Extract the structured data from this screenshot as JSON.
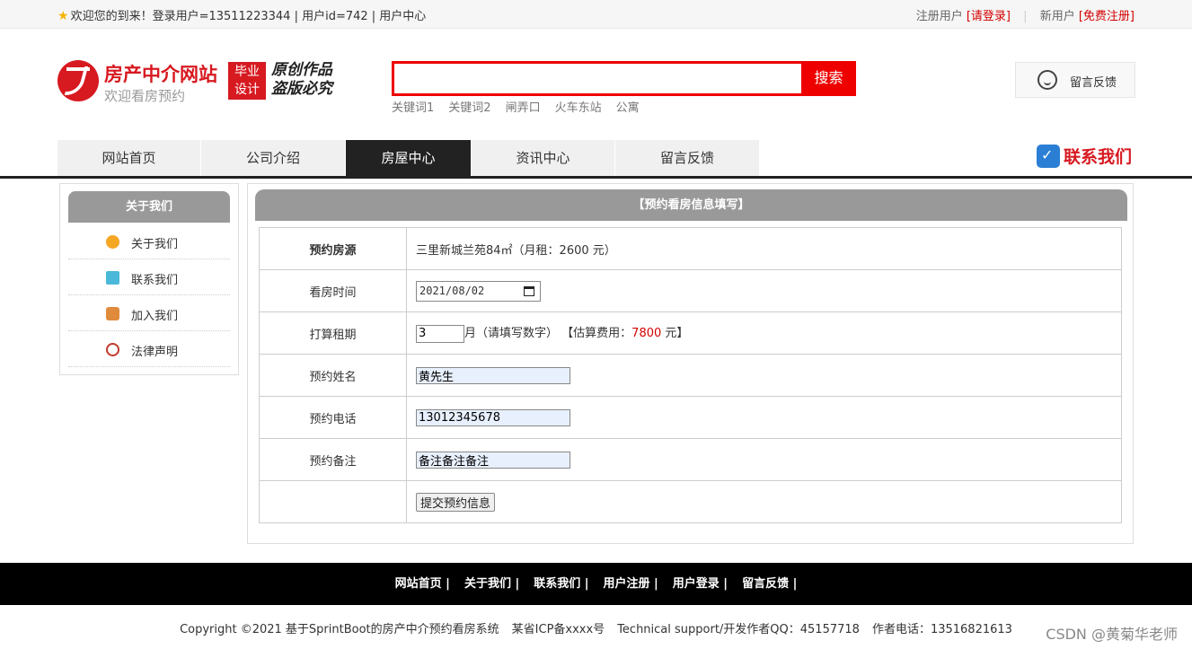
{
  "topbar": {
    "welcome": "欢迎您的到来！登录用户=13511223344 | 用户id=742 | 用户中心",
    "registered_user": "注册用户",
    "login_link": "[请登录]",
    "new_user": "新用户",
    "register_link": "[免费注册]"
  },
  "header": {
    "site_title": "房产中介网站",
    "site_subtitle": "欢迎看房预约",
    "badge_line1": "毕业",
    "badge_line2": "设计",
    "slogan_line1": "原创作品",
    "slogan_line2": "盗版必究",
    "search_button": "搜索",
    "search_value": "",
    "keywords": [
      "关键词1",
      "关键词2",
      "闸弄口",
      "火车东站",
      "公寓"
    ],
    "feedback_button": "留言反馈"
  },
  "nav": {
    "items": [
      "网站首页",
      "公司介绍",
      "房屋中心",
      "资讯中心",
      "留言反馈"
    ],
    "active_index": 2,
    "contact": "联系我们"
  },
  "sidebar": {
    "title": "关于我们",
    "items": [
      "关于我们",
      "联系我们",
      "加入我们",
      "法律声明"
    ]
  },
  "form": {
    "title": "【预约看房信息填写】",
    "rows": {
      "house_label": "预约房源",
      "house_value": "三里新城兰苑84㎡（月租：2600 元）",
      "time_label": "看房时间",
      "time_value": "2021/08/02",
      "term_label": "打算租期",
      "term_value": "3",
      "term_hint": "月（请填写数字）",
      "estimate_prefix": "【估算费用：",
      "estimate_value": "7800",
      "estimate_suffix": " 元】",
      "name_label": "预约姓名",
      "name_value": "黄先生",
      "phone_label": "预约电话",
      "phone_value": "13012345678",
      "note_label": "预约备注",
      "note_value": "备注备注备注",
      "submit": "提交预约信息"
    }
  },
  "footer": {
    "links": [
      "网站首页 |",
      "关于我们 |",
      "联系我们 |",
      "用户注册 |",
      "用户登录 |",
      "留言反馈 |"
    ],
    "copyright": "Copyright ©2021 基于SprintBoot的房产中介预约看房系统",
    "icp": "某省ICP备xxxx号",
    "support": "Technical support/开发作者QQ：45157718",
    "phone": "作者电话：13516821613",
    "watermark": "CSDN @黄菊华老师"
  },
  "colors": {
    "brand_red": "#d71920",
    "nav_active": "#222222",
    "panel_header": "#999999"
  }
}
